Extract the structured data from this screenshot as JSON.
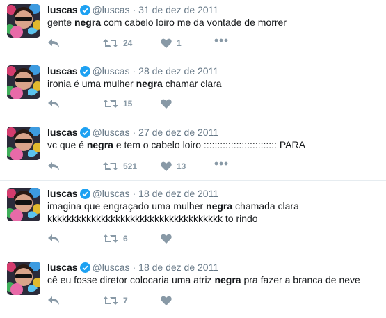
{
  "account": {
    "name": "luscas",
    "handle": "@luscas",
    "verified_icon": "verified-badge-icon",
    "accent": "#1da1f2"
  },
  "separator": "·",
  "tweets": [
    {
      "date": "31 de dez de 2011",
      "text_parts": [
        "gente ",
        "negra",
        " com cabelo loiro me da vontade de morrer"
      ],
      "line2": "",
      "retweets": "24",
      "likes": "1"
    },
    {
      "date": "28 de dez de 2011",
      "text_parts": [
        "ironia é uma mulher ",
        "negra",
        " chamar clara"
      ],
      "line2": "",
      "retweets": "15",
      "likes": ""
    },
    {
      "date": "27 de dez de 2011",
      "text_parts": [
        "vc que é ",
        "negra",
        " e tem o cabelo loiro ::::::::::::::::::::::::::: PARA"
      ],
      "line2": "",
      "retweets": "521",
      "likes": "13"
    },
    {
      "date": "18 de dez de 2011",
      "text_parts": [
        "imagina que engraçado uma mulher ",
        "negra",
        " chamada clara"
      ],
      "line2": "kkkkkkkkkkkkkkkkkkkkkkkkkkkkkkkkkkkk to rindo",
      "retweets": "6",
      "likes": ""
    },
    {
      "date": "18 de dez de 2011",
      "text_parts": [
        "cê eu fosse diretor colocaria uma atriz ",
        "negra",
        " pra fazer a branca de neve"
      ],
      "line2": "",
      "retweets": "7",
      "likes": ""
    }
  ],
  "icons": {
    "reply": "reply-icon",
    "retweet": "retweet-icon",
    "like": "heart-icon",
    "more": "more-icon"
  }
}
